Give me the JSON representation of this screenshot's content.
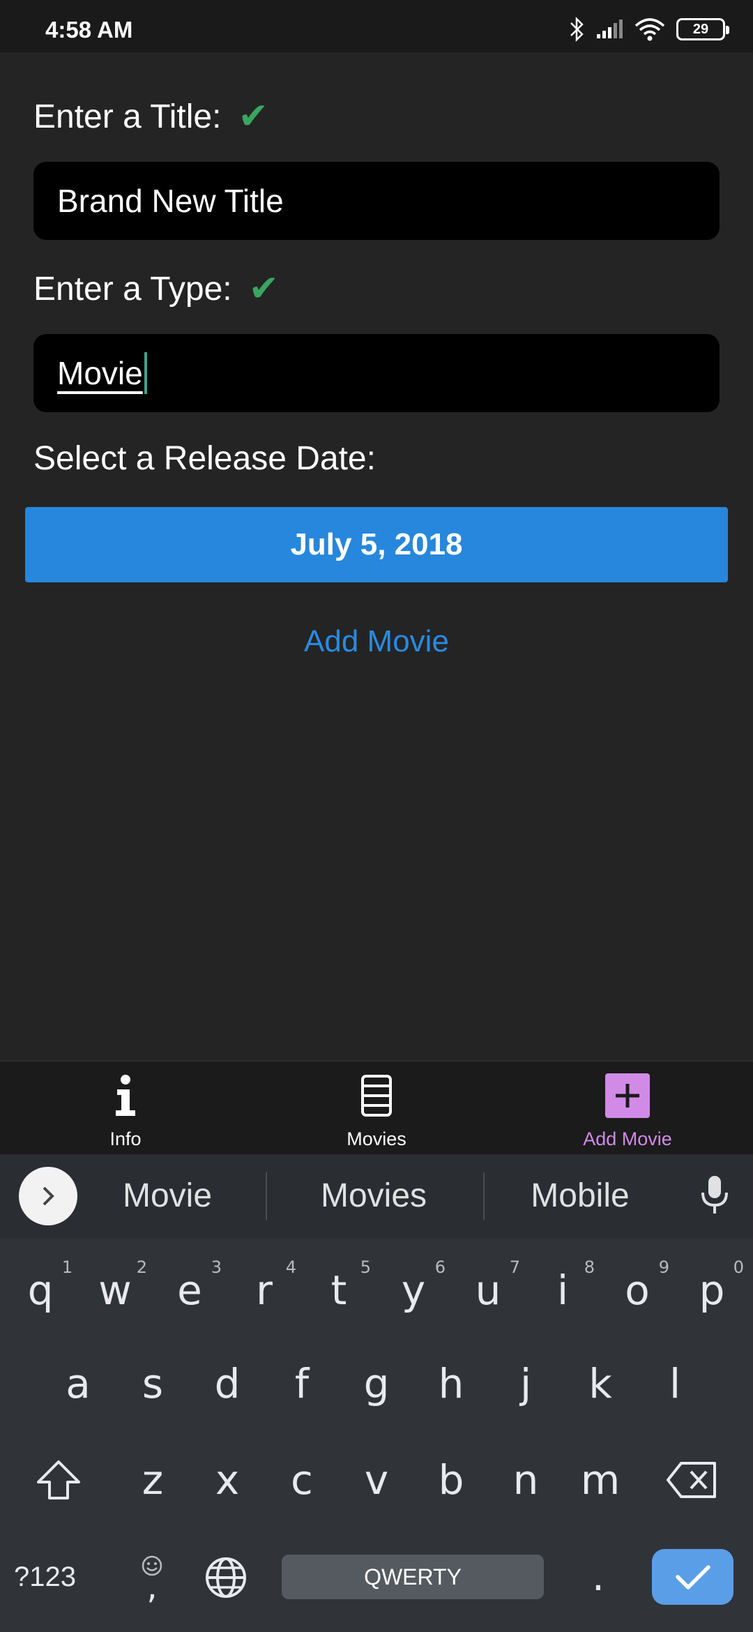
{
  "status": {
    "time": "4:58 AM",
    "battery": "29"
  },
  "form": {
    "title_label": "Enter a Title:",
    "title_value": "Brand New Title",
    "type_label": "Enter a Type:",
    "type_value": "Movie",
    "date_label": "Select a Release Date:",
    "date_value": "July 5, 2018",
    "submit_label": "Add Movie",
    "valid_mark": "✔"
  },
  "nav": {
    "items": [
      {
        "label": "Info",
        "icon": "info-icon"
      },
      {
        "label": "Movies",
        "icon": "list-icon"
      },
      {
        "label": "Add Movie",
        "icon": "add-icon",
        "active": true
      }
    ],
    "active_color": "#d18be6"
  },
  "keyboard": {
    "suggestions": [
      "Movie",
      "Movies",
      "Mobile"
    ],
    "row1": [
      {
        "k": "q",
        "n": "1"
      },
      {
        "k": "w",
        "n": "2"
      },
      {
        "k": "e",
        "n": "3"
      },
      {
        "k": "r",
        "n": "4"
      },
      {
        "k": "t",
        "n": "5"
      },
      {
        "k": "y",
        "n": "6"
      },
      {
        "k": "u",
        "n": "7"
      },
      {
        "k": "i",
        "n": "8"
      },
      {
        "k": "o",
        "n": "9"
      },
      {
        "k": "p",
        "n": "0"
      }
    ],
    "row2": [
      "a",
      "s",
      "d",
      "f",
      "g",
      "h",
      "j",
      "k",
      "l"
    ],
    "row3": [
      "z",
      "x",
      "c",
      "v",
      "b",
      "n",
      "m"
    ],
    "symbols_label": "?123",
    "comma": ",",
    "period": ".",
    "space_label": "QWERTY"
  },
  "colors": {
    "accent": "#2687dc",
    "check": "#3aa55f",
    "enter": "#5a9ee8"
  }
}
